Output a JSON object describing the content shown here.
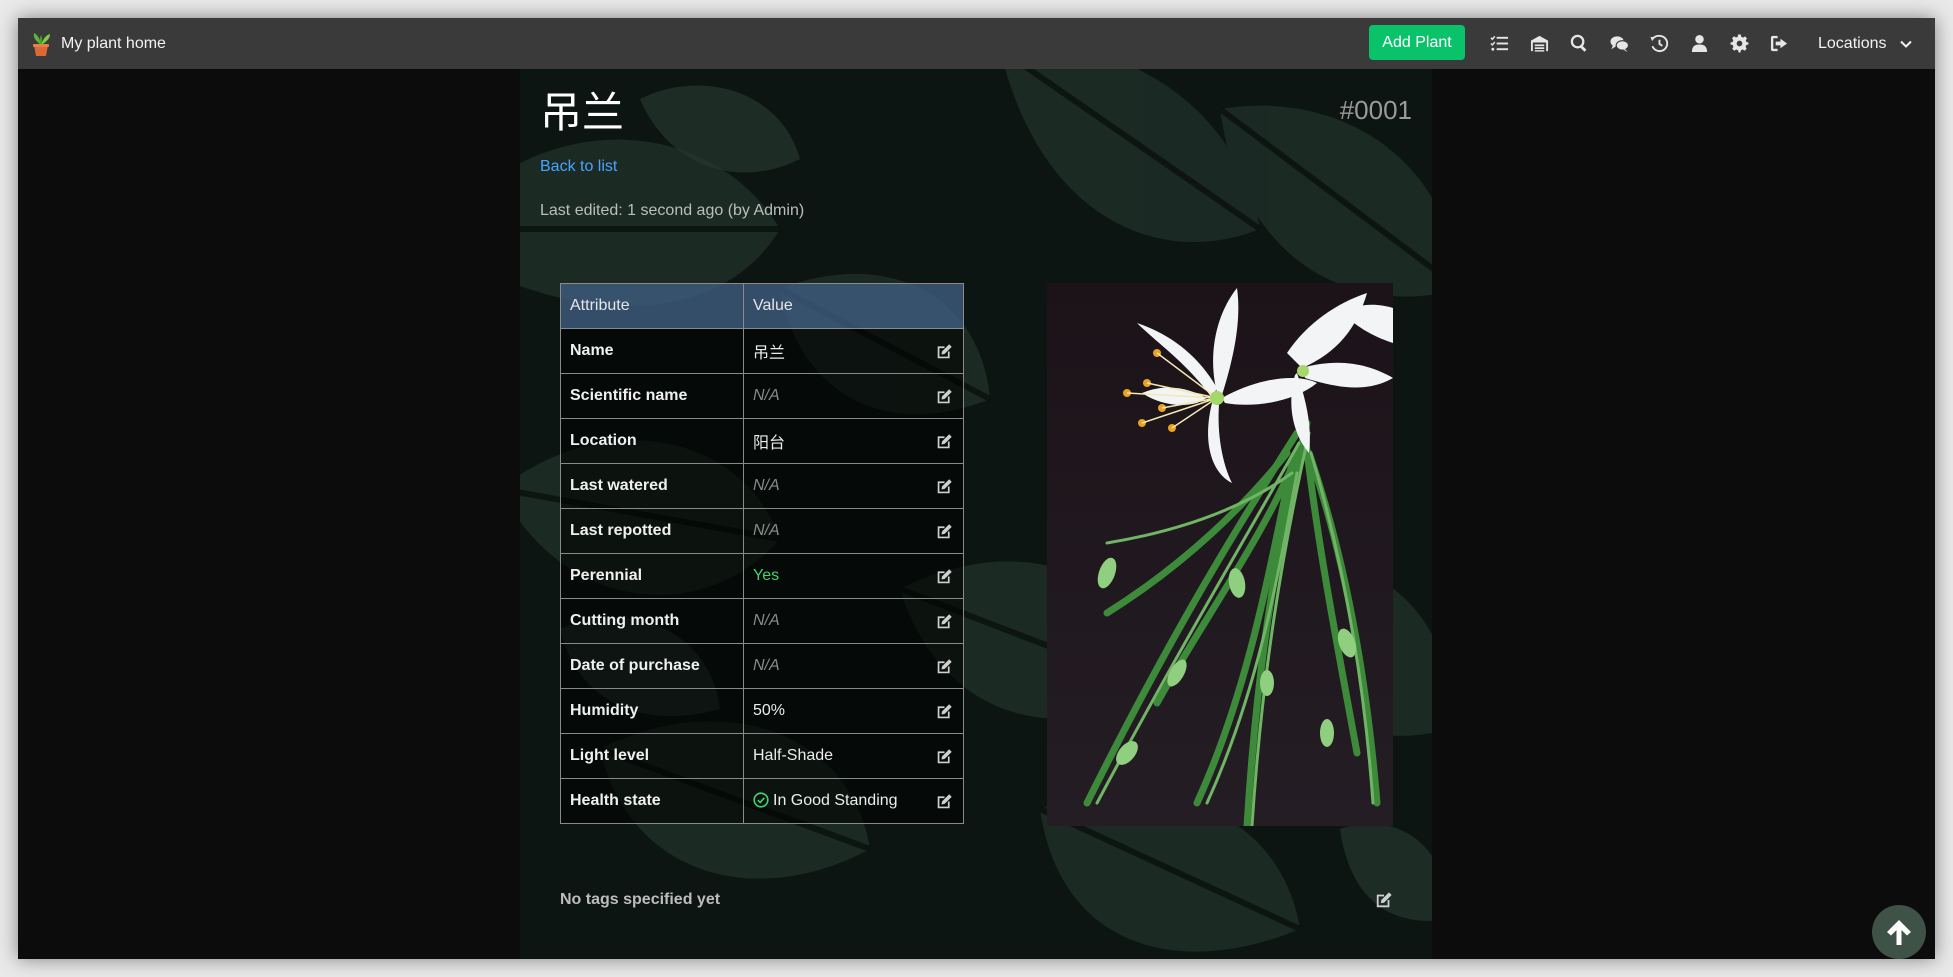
{
  "navbar": {
    "brand": "My plant home",
    "add_plant": "Add Plant",
    "locations": "Locations",
    "icons": [
      "tasks-icon",
      "inventory-icon",
      "search-icon",
      "chat-icon",
      "history-icon",
      "user-icon",
      "settings-icon",
      "logout-icon"
    ]
  },
  "plant": {
    "title": "吊兰",
    "id": "#0001",
    "back": "Back to list",
    "edited": "Last edited: 1 second ago (by Admin)"
  },
  "table": {
    "headers": {
      "attribute": "Attribute",
      "value": "Value"
    },
    "rows": [
      {
        "key": "Name",
        "value": "吊兰",
        "state": "normal"
      },
      {
        "key": "Scientific name",
        "value": "N/A",
        "state": "na"
      },
      {
        "key": "Location",
        "value": "阳台",
        "state": "normal"
      },
      {
        "key": "Last watered",
        "value": "N/A",
        "state": "na"
      },
      {
        "key": "Last repotted",
        "value": "N/A",
        "state": "na"
      },
      {
        "key": "Perennial",
        "value": "Yes",
        "state": "yes"
      },
      {
        "key": "Cutting month",
        "value": "N/A",
        "state": "na"
      },
      {
        "key": "Date of purchase",
        "value": "N/A",
        "state": "na"
      },
      {
        "key": "Humidity",
        "value": "50%",
        "state": "normal"
      },
      {
        "key": "Light level",
        "value": "Half-Shade",
        "state": "normal"
      },
      {
        "key": "Health state",
        "value": "In Good Standing",
        "state": "health"
      }
    ]
  },
  "tags": {
    "empty_text": "No tags specified yet"
  },
  "colors": {
    "accent_green": "#0ac26a",
    "link_blue": "#4aa3ff",
    "yes_green": "#3fd46f",
    "header_blue": "#3d5b7e"
  }
}
